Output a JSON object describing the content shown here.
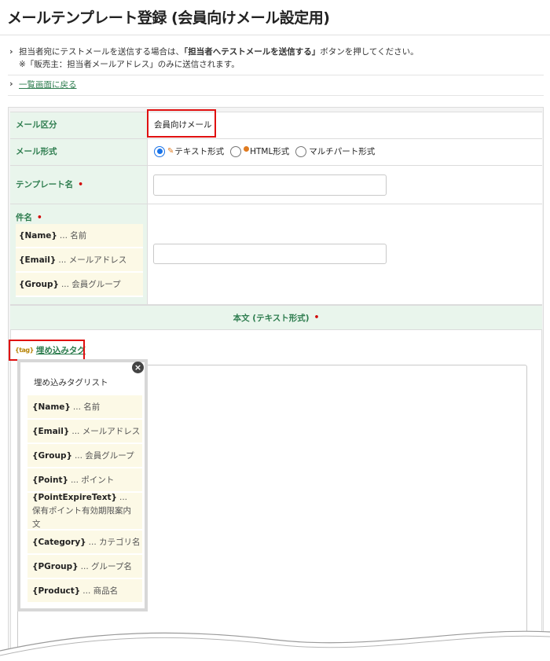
{
  "page": {
    "title": "メールテンプレート登録 (会員向けメール設定用)"
  },
  "notes": {
    "line1_prefix": "担当者宛にテストメールを送信する場合は、",
    "line1_bold": "「担当者へテストメールを送信する」",
    "line1_suffix": "ボタンを押してください。",
    "line2": "※「販売主：担当者メールアドレス」のみに送信されます。"
  },
  "back_link": "一覧画面に戻る",
  "form": {
    "mail_type": {
      "label": "メール区分",
      "value": "会員向けメール"
    },
    "mail_format": {
      "label": "メール形式",
      "options": [
        "テキスト形式",
        "HTML形式",
        "マルチパート形式"
      ],
      "selected": "テキスト形式"
    },
    "template_name": {
      "label": "テンプレート名",
      "required_mark": "•",
      "value": ""
    },
    "subject": {
      "label": "件名",
      "required_mark": "•",
      "value": "",
      "tags": [
        {
          "tag": "{Name}",
          "desc": "... 名前"
        },
        {
          "tag": "{Email}",
          "desc": "... メールアドレス"
        },
        {
          "tag": "{Group}",
          "desc": "... 会員グループ"
        }
      ]
    },
    "body": {
      "header": "本文 (テキスト形式)",
      "required_mark": "•",
      "embed_tag_icon": "{tag}",
      "embed_tag_link": "埋め込みタグ",
      "tag_popup": {
        "title": "埋め込みタグリスト",
        "close_icon": "×",
        "items": [
          {
            "tag": "{Name}",
            "desc": "... 名前"
          },
          {
            "tag": "{Email}",
            "desc": "... メールアドレス"
          },
          {
            "tag": "{Group}",
            "desc": "... 会員グループ"
          },
          {
            "tag": "{Point}",
            "desc": "... ポイント"
          },
          {
            "tag": "{PointExpireText}",
            "desc": "... 保有ポイント有効期限案内文"
          },
          {
            "tag": "{Category}",
            "desc": "... カテゴリ名"
          },
          {
            "tag": "{PGroup}",
            "desc": "... グループ名"
          },
          {
            "tag": "{Product}",
            "desc": "... 商品名"
          }
        ]
      }
    }
  },
  "colors": {
    "label_green": "#2e7d4f",
    "label_bg": "#e9f5ec",
    "tag_bg": "#fcf9e6",
    "highlight_red": "#e01010",
    "radio_blue": "#1a73e8"
  }
}
